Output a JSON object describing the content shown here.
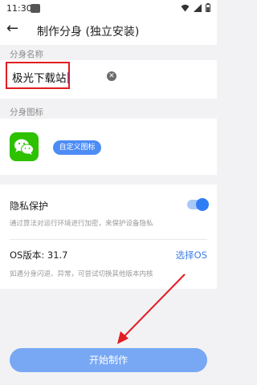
{
  "status_bar": {
    "time": "11:30"
  },
  "header": {
    "title": "制作分身 (独立安装)"
  },
  "name_section": {
    "label": "分身名称",
    "value": "极光下载站"
  },
  "icon_section": {
    "label": "分身图标",
    "custom_button": "自定义图标",
    "icon": "wechat-icon"
  },
  "privacy": {
    "title": "隐私保护",
    "description": "通过算法对运行环境进行加密，来保护设备隐私",
    "enabled": true
  },
  "os": {
    "version_label": "OS版本: 31.7",
    "select_label": "选择OS",
    "hint": "如遇分身闪退、异常，可尝试切换其他版本内核"
  },
  "start_button": {
    "label": "开始制作"
  },
  "colors": {
    "accent": "#2f7df5",
    "highlight": "#e11c23",
    "button": "#78a8f4"
  }
}
